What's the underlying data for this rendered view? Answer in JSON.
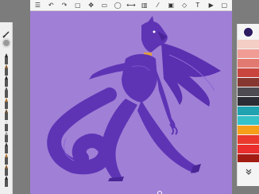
{
  "toolbar": {
    "tools": [
      {
        "name": "menu-icon",
        "glyph": "☰"
      },
      {
        "name": "undo-icon",
        "glyph": "↶"
      },
      {
        "name": "redo-icon",
        "glyph": "↷"
      },
      {
        "name": "layers-icon",
        "glyph": "▢"
      },
      {
        "name": "transform-icon",
        "glyph": "✥"
      },
      {
        "name": "crop-icon",
        "glyph": "▭"
      },
      {
        "name": "lasso-icon",
        "glyph": "◯"
      },
      {
        "name": "symmetry-icon",
        "glyph": "⟷"
      },
      {
        "name": "fill-icon",
        "glyph": "▥"
      },
      {
        "name": "ruler-icon",
        "glyph": "⁄"
      },
      {
        "name": "image-icon",
        "glyph": "▣"
      },
      {
        "name": "effects-icon",
        "glyph": "◇"
      },
      {
        "name": "text-icon",
        "glyph": "T"
      },
      {
        "name": "video-icon",
        "glyph": "▶"
      },
      {
        "name": "fullscreen-icon",
        "glyph": "▢"
      }
    ]
  },
  "left_rail": {
    "tools": [
      "pencil-icon",
      "marker-icon",
      "pen-icon",
      "airbrush-icon",
      "brush-icon",
      "brush-icon",
      "eraser-icon",
      "smudge-icon",
      "pencil-icon",
      "brush-icon",
      "brush-icon",
      "marker-icon"
    ]
  },
  "palette": {
    "current": "#2d1b62",
    "swatches": [
      "#f4cdc4",
      "#f09c95",
      "#e37a72",
      "#c9463e",
      "#863730",
      "#4f4b52",
      "#2c2c34",
      "#1fa3b1",
      "#35c1c8",
      "#f6a01a",
      "#ea3a2d",
      "#ea2d2d",
      "#a31c14"
    ]
  },
  "canvas": {
    "background": "#a07fd6",
    "figure_color": "#5e34b5"
  }
}
